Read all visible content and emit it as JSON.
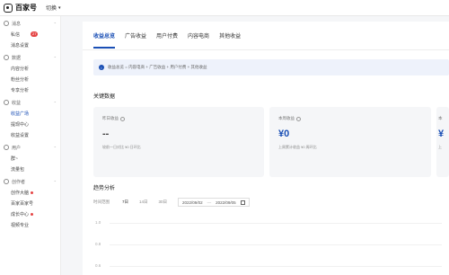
{
  "topbar": {
    "logo_text": "百家号",
    "account_label": "切换"
  },
  "sidebar": {
    "groups": [
      {
        "label": "消息",
        "items": [
          {
            "label": "私信",
            "badge": "27"
          },
          {
            "label": "消息设置"
          }
        ]
      },
      {
        "label": "数据",
        "items": [
          {
            "label": "内容分析"
          },
          {
            "label": "粉丝分析"
          },
          {
            "label": "专享分析"
          }
        ]
      },
      {
        "label": "收益",
        "items": [
          {
            "label": "收益广场"
          },
          {
            "label": "提现中心"
          },
          {
            "label": "收益设置"
          }
        ]
      },
      {
        "label": "用户",
        "items": [
          {
            "label": "群~"
          },
          {
            "label": "流量包"
          }
        ]
      },
      {
        "label": "创作者",
        "items": [
          {
            "label": "创作大脑"
          },
          {
            "label": "百家百家号"
          },
          {
            "label": "成长中心"
          },
          {
            "label": "视频专业"
          }
        ]
      }
    ]
  },
  "tabs": [
    "收益总览",
    "广告收益",
    "用户付费",
    "内容电商",
    "其他收益"
  ],
  "notice": {
    "text": "收益总览 = 内容电商 + 广告收益 + 用户付费 + 其他收益"
  },
  "key_data": {
    "title": "关键数据",
    "cards": [
      {
        "label": "昨日收益",
        "value": "--",
        "footer": "较前一日对比 ¥0   日环比"
      },
      {
        "label": "本周收益",
        "value": "¥0",
        "footer": "上周累计收益 ¥0   周环比"
      },
      {
        "label": "本",
        "value": "¥",
        "footer": "上"
      }
    ]
  },
  "trend": {
    "title": "趋势分析",
    "filter_label": "时间范围",
    "options": [
      "7日",
      "14日",
      "30日"
    ],
    "start_date": "2022/09/02",
    "end_date": "2022/09/05",
    "y_ticks": [
      "1.0",
      "0.8",
      "0.6"
    ]
  }
}
